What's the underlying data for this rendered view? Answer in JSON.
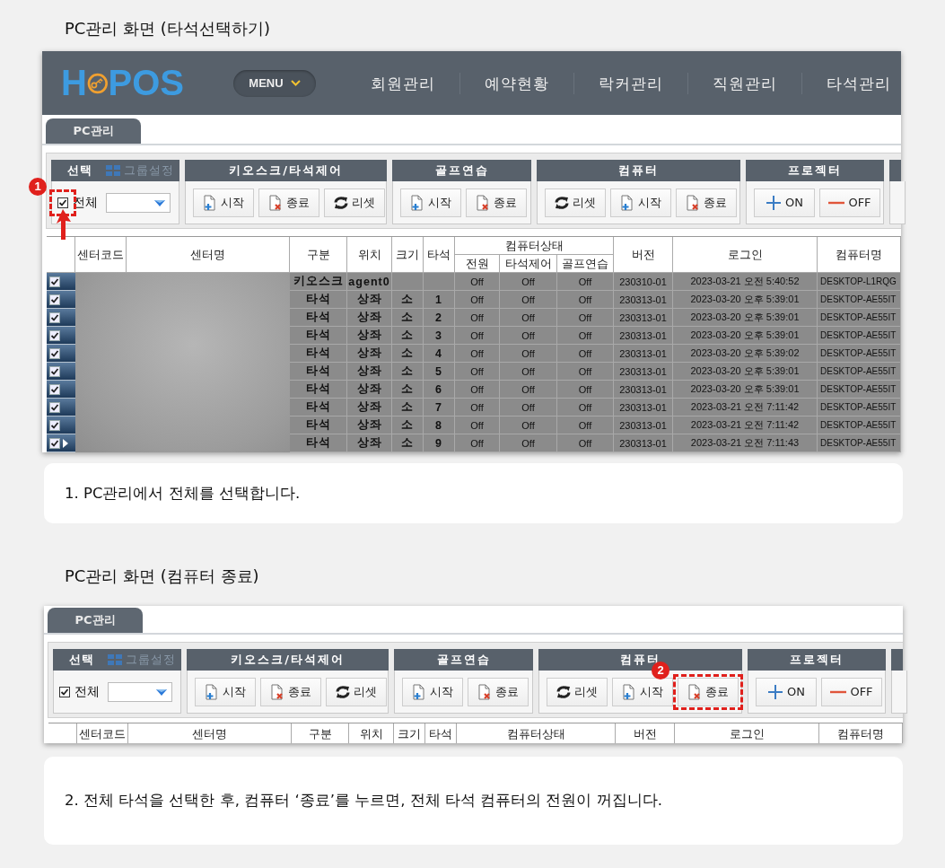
{
  "sections": [
    {
      "title": "PC관리 화면 (타석선택하기)",
      "screen": {
        "header": {
          "logo_start": "H",
          "logo_end": "POS",
          "menu": "MENU",
          "nav": [
            "회원관리",
            "예약현황",
            "락커관리",
            "직원관리",
            "타석관리"
          ]
        },
        "tabs": [
          {
            "label": "PC관리",
            "selected": true
          }
        ],
        "select_group": {
          "title": "선택",
          "group_setting": "그룹설정",
          "checkbox": {
            "label": "전체",
            "checked": true,
            "callout": {
              "badge": "1",
              "arrow": true
            }
          }
        },
        "groups": [
          {
            "title": "키오스크/타석제어",
            "buttons": [
              {
                "kind": "start",
                "label": "시작"
              },
              {
                "kind": "stop",
                "label": "종료"
              },
              {
                "kind": "reset",
                "label": "리셋"
              }
            ]
          },
          {
            "title": "골프연습",
            "buttons": [
              {
                "kind": "start",
                "label": "시작"
              },
              {
                "kind": "stop",
                "label": "종료"
              }
            ]
          },
          {
            "title": "컴퓨터",
            "buttons": [
              {
                "kind": "reset",
                "label": "리셋"
              },
              {
                "kind": "start",
                "label": "시작"
              },
              {
                "kind": "stop",
                "label": "종료"
              }
            ]
          },
          {
            "title": "프로젝터",
            "buttons": [
              {
                "kind": "on",
                "label": "ON"
              },
              {
                "kind": "off",
                "label": "OFF"
              }
            ]
          }
        ],
        "table": {
          "columns": [
            {
              "label": "센터코드"
            },
            {
              "label": "센터명"
            },
            {
              "label": "구분"
            },
            {
              "label": "위치"
            },
            {
              "label": "크기"
            },
            {
              "label": "타석"
            },
            {
              "label": "컴퓨터상태",
              "children": [
                {
                  "label": "전원"
                },
                {
                  "label": "타석제어"
                },
                {
                  "label": "골프연습"
                }
              ]
            },
            {
              "label": "버전"
            },
            {
              "label": "로그인"
            },
            {
              "label": "컴퓨터명"
            }
          ],
          "rows": [
            {
              "checked": true,
              "current": false,
              "type": "키오스크",
              "location": "agent0",
              "power": "Off",
              "seat_control": "Off",
              "golf": "Off",
              "version": "230310-01",
              "login": "2023-03-21 오전 5:40:52",
              "computer": "DESKTOP-L1RQG"
            },
            {
              "checked": true,
              "current": false,
              "type": "타석",
              "location": "상좌",
              "size": "소",
              "seat": "1",
              "power": "Off",
              "seat_control": "Off",
              "golf": "Off",
              "version": "230313-01",
              "login": "2023-03-20 오후 5:39:01",
              "computer": "DESKTOP-AE55IT"
            },
            {
              "checked": true,
              "current": false,
              "type": "타석",
              "location": "상좌",
              "size": "소",
              "seat": "2",
              "power": "Off",
              "seat_control": "Off",
              "golf": "Off",
              "version": "230313-01",
              "login": "2023-03-20 오후 5:39:01",
              "computer": "DESKTOP-AE55IT"
            },
            {
              "checked": true,
              "current": false,
              "type": "타석",
              "location": "상좌",
              "size": "소",
              "seat": "3",
              "power": "Off",
              "seat_control": "Off",
              "golf": "Off",
              "version": "230313-01",
              "login": "2023-03-20 오후 5:39:01",
              "computer": "DESKTOP-AE55IT"
            },
            {
              "checked": true,
              "current": false,
              "type": "타석",
              "location": "상좌",
              "size": "소",
              "seat": "4",
              "power": "Off",
              "seat_control": "Off",
              "golf": "Off",
              "version": "230313-01",
              "login": "2023-03-20 오후 5:39:02",
              "computer": "DESKTOP-AE55IT"
            },
            {
              "checked": true,
              "current": false,
              "type": "타석",
              "location": "상좌",
              "size": "소",
              "seat": "5",
              "power": "Off",
              "seat_control": "Off",
              "golf": "Off",
              "version": "230313-01",
              "login": "2023-03-20 오후 5:39:01",
              "computer": "DESKTOP-AE55IT"
            },
            {
              "checked": true,
              "current": false,
              "type": "타석",
              "location": "상좌",
              "size": "소",
              "seat": "6",
              "power": "Off",
              "seat_control": "Off",
              "golf": "Off",
              "version": "230313-01",
              "login": "2023-03-20 오후 5:39:01",
              "computer": "DESKTOP-AE55IT"
            },
            {
              "checked": true,
              "current": false,
              "type": "타석",
              "location": "상좌",
              "size": "소",
              "seat": "7",
              "power": "Off",
              "seat_control": "Off",
              "golf": "Off",
              "version": "230313-01",
              "login": "2023-03-21 오전 7:11:42",
              "computer": "DESKTOP-AE55IT"
            },
            {
              "checked": true,
              "current": false,
              "type": "타석",
              "location": "상좌",
              "size": "소",
              "seat": "8",
              "power": "Off",
              "seat_control": "Off",
              "golf": "Off",
              "version": "230313-01",
              "login": "2023-03-21 오전 7:11:42",
              "computer": "DESKTOP-AE55IT"
            },
            {
              "checked": true,
              "current": true,
              "type": "타석",
              "location": "상좌",
              "size": "소",
              "seat": "9",
              "power": "Off",
              "seat_control": "Off",
              "golf": "Off",
              "version": "230313-01",
              "login": "2023-03-21 오전 7:11:43",
              "computer": "DESKTOP-AE55IT"
            }
          ]
        }
      },
      "caption": "1. PC관리에서 전체를 선택합니다."
    },
    {
      "title": "PC관리 화면 (컴퓨터 종료)",
      "screen": {
        "tabs": [
          {
            "label": "PC관리",
            "selected": true
          }
        ],
        "select_group": {
          "title": "선택",
          "group_setting": "그룹설정",
          "checkbox": {
            "label": "전체",
            "checked": true
          }
        },
        "groups": [
          {
            "title": "키오스크/타석제어",
            "buttons": [
              {
                "kind": "start",
                "label": "시작"
              },
              {
                "kind": "stop",
                "label": "종료"
              },
              {
                "kind": "reset",
                "label": "리셋"
              }
            ]
          },
          {
            "title": "골프연습",
            "buttons": [
              {
                "kind": "start",
                "label": "시작"
              },
              {
                "kind": "stop",
                "label": "종료"
              }
            ]
          },
          {
            "title": "컴퓨터",
            "buttons": [
              {
                "kind": "reset",
                "label": "리셋"
              },
              {
                "kind": "start",
                "label": "시작"
              },
              {
                "kind": "stop",
                "label": "종료",
                "callout": {
                  "badge": "2",
                  "arrow": false
                }
              }
            ]
          },
          {
            "title": "프로젝터",
            "buttons": [
              {
                "kind": "on",
                "label": "ON"
              },
              {
                "kind": "off",
                "label": "OFF"
              }
            ]
          }
        ],
        "table": {
          "columns": [
            {
              "label": "센터코드"
            },
            {
              "label": "센터명"
            },
            {
              "label": "구분"
            },
            {
              "label": "위치"
            },
            {
              "label": "크기"
            },
            {
              "label": "타석"
            },
            {
              "label": "컴퓨터상태"
            },
            {
              "label": "버전"
            },
            {
              "label": "로그인"
            },
            {
              "label": "컴퓨터명"
            }
          ]
        }
      },
      "caption": "2. 전체 타석을 선택한 후, 컴퓨터 ‘종료’를 누르면, 전체 타석 컴퓨터의 전원이 꺼집니다."
    }
  ]
}
